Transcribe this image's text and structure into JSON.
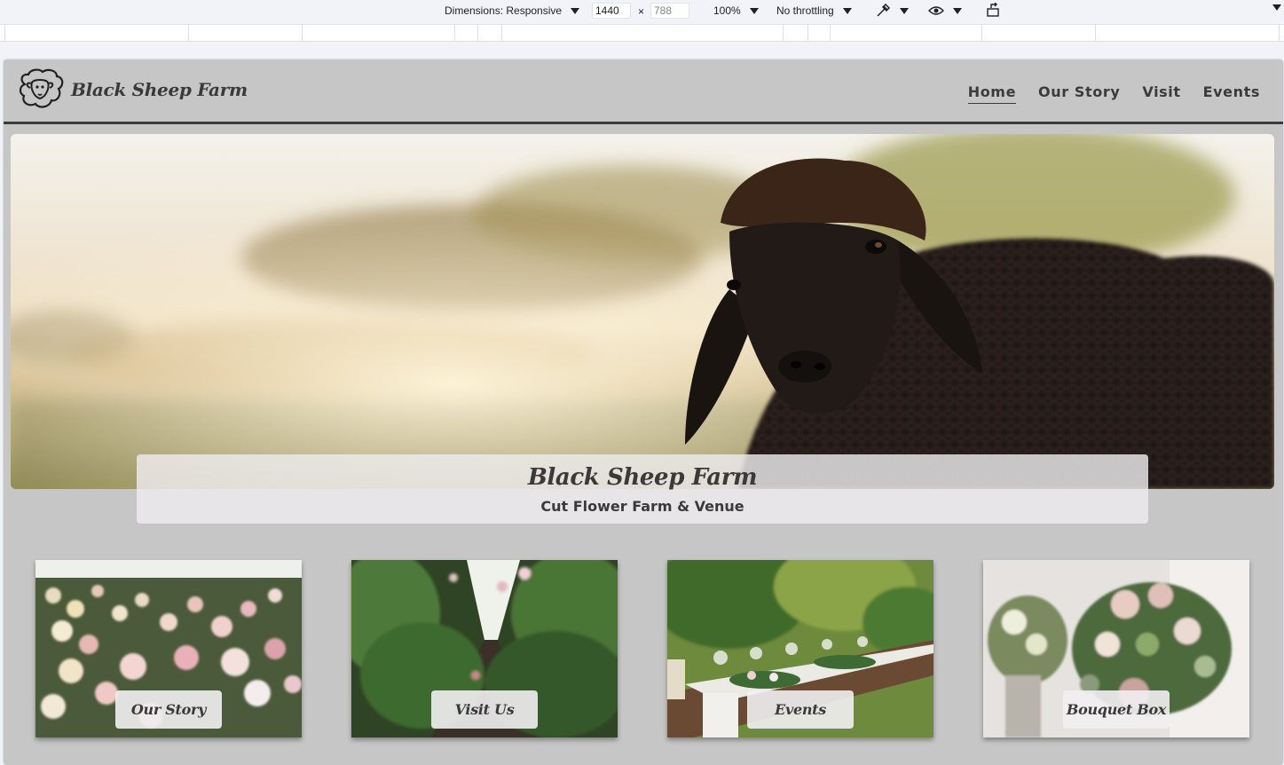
{
  "devtools": {
    "dimensions_label": "Dimensions: Responsive",
    "width_value": "1440",
    "times_symbol": "×",
    "height_placeholder": "788",
    "zoom": "100%",
    "throttling": "No throttling",
    "icons": [
      "eyedropper-icon",
      "eye-icon",
      "rotate-icon"
    ]
  },
  "site": {
    "logo_text": "Black Sheep Farm",
    "logo_icon": "sheep-icon",
    "nav": [
      {
        "label": "Home",
        "active": true
      },
      {
        "label": "Our Story",
        "active": false
      },
      {
        "label": "Visit",
        "active": false
      },
      {
        "label": "Events",
        "active": false
      }
    ],
    "hero": {
      "title": "Black Sheep Farm",
      "subtitle": "Cut Flower Farm & Venue",
      "image": "black-sheep-photo"
    },
    "cards": [
      {
        "label": "Our Story",
        "image": "dahlia-field-photo"
      },
      {
        "label": "Visit Us",
        "image": "flower-row-path-photo"
      },
      {
        "label": "Events",
        "image": "outdoor-wedding-table-photo"
      },
      {
        "label": "Bouquet Box",
        "image": "bouquet-photo"
      }
    ]
  },
  "colors": {
    "page_background": "#c6c6c6",
    "text": "#3a3a3a",
    "header_rule": "#3b3b3b",
    "caption_background": "#eeecee"
  }
}
